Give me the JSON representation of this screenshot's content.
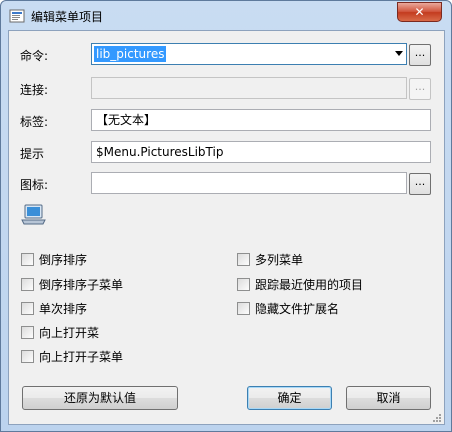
{
  "window": {
    "title": "编辑菜单项目",
    "close_label": "✕"
  },
  "fields": {
    "command_label": "命令:",
    "command_value": "lib_pictures",
    "link_label": "连接:",
    "link_value": "",
    "tag_label": "标签:",
    "tag_value": "【无文本】",
    "tip_label": "提示",
    "tip_value": "$Menu.PicturesLibTip",
    "icon_label": "图标:",
    "icon_value": "",
    "browse_label": "..."
  },
  "options": {
    "left": [
      "倒序排序",
      "倒序排序子菜单",
      "单次排序",
      "向上打开菜",
      "向上打开子菜单"
    ],
    "right": [
      "多列菜单",
      "跟踪最近使用的项目",
      "隐藏文件扩展名"
    ]
  },
  "buttons": {
    "reset": "还原为默认值",
    "ok": "确定",
    "cancel": "取消"
  }
}
